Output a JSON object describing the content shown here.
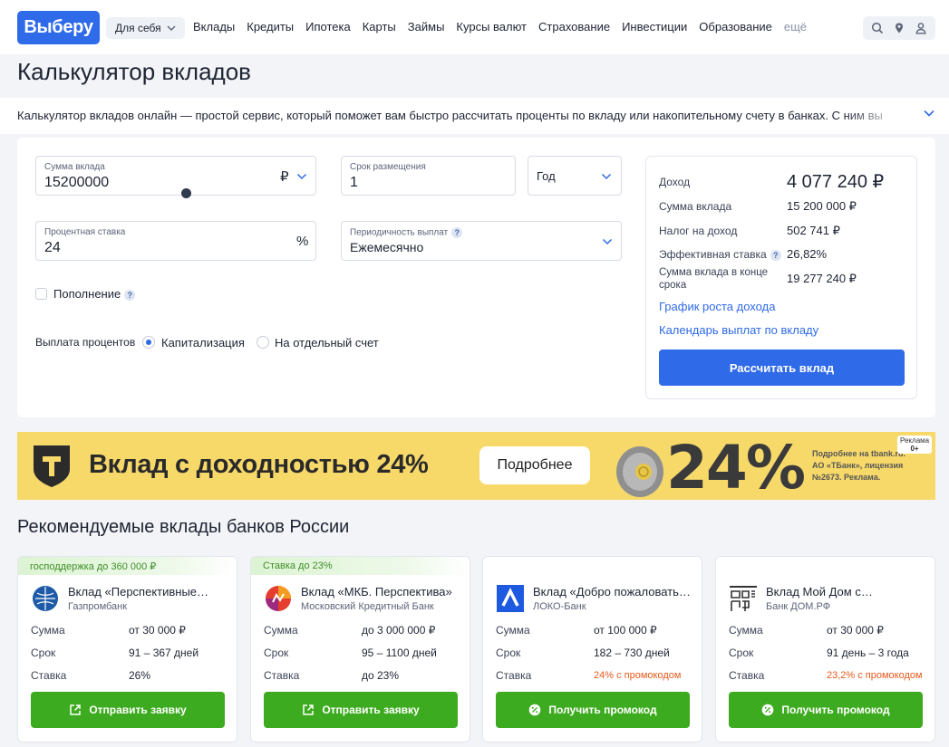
{
  "header": {
    "logo": "Выберу",
    "for_self": "Для себя",
    "nav": [
      "Вклады",
      "Кредиты",
      "Ипотека",
      "Карты",
      "Займы",
      "Курсы валют",
      "Страхование",
      "Инвестиции",
      "Образование"
    ],
    "more": "ещё",
    "icons": [
      "search-icon",
      "location-icon",
      "user-icon"
    ]
  },
  "page": {
    "title": "Калькулятор вкладов",
    "intro": "Калькулятор вкладов онлайн — простой сервис, который поможет вам быстро рассчитать проценты по вкладу или накопительному счету в банках. С ним вы"
  },
  "calculator": {
    "amount": {
      "label": "Сумма вклада",
      "value": "15200000",
      "currency": "₽"
    },
    "term": {
      "label": "Срок размещения",
      "value": "1",
      "unit": "Год"
    },
    "rate": {
      "label": "Процентная ставка",
      "value": "24",
      "suffix": "%"
    },
    "payout": {
      "label": "Периодичность выплат",
      "value": "Ежемесячно"
    },
    "topup": {
      "label": "Пополнение",
      "checked": false
    },
    "interest": {
      "label": "Выплата процентов",
      "options": [
        "Капитализация",
        "На отдельный счет"
      ],
      "selected": "Капитализация"
    },
    "slider_level": 0.73,
    "result": {
      "income_label": "Доход",
      "income_value": "4 077 240 ₽",
      "rows": [
        {
          "label": "Сумма вклада",
          "value": "15 200 000 ₽"
        },
        {
          "label": "Налог на доход",
          "value": "502 741 ₽"
        },
        {
          "label": "Эффективная ставка",
          "value": "26,82%"
        },
        {
          "label": "Сумма вклада в конце срока",
          "value": "19 277 240 ₽"
        }
      ],
      "links": [
        "График роста дохода",
        "Календарь выплат по вкладу"
      ],
      "button": "Рассчитать вклад"
    }
  },
  "banner": {
    "title": "Вклад с доходностью 24%",
    "button": "Подробнее",
    "big": "24%",
    "small": [
      "Подробнее на tbank.ru.",
      "АО «ТБанк», лицензия",
      "№2673. Реклама."
    ],
    "ad_label": "Реклама",
    "age": "0+"
  },
  "recommended": {
    "title": "Рекомендуемые вклады банков России",
    "labels": {
      "amount": "Сумма",
      "term": "Срок",
      "rate": "Ставка"
    },
    "cards": [
      {
        "promo": "господдержка до 360 000 ₽",
        "name": "Вклад «Перспективные…",
        "bank": "Газпромбанк",
        "amount": "от 30 000 ₽",
        "term": "91 – 367 дней",
        "rate": "26%",
        "button": "Отправить заявку",
        "logo": "gazprombank-logo"
      },
      {
        "promo": "Ставка до 23%",
        "name": "Вклад «МКБ. Перспектива»",
        "bank": "Московский Кредитный Банк",
        "amount": "до 3 000 000 ₽",
        "term": "95 – 1100 дней",
        "rate": "до 23%",
        "button": "Отправить заявку",
        "logo": "mkb-logo"
      },
      {
        "promo": "",
        "name": "Вклад «Добро пожаловать…",
        "bank": "ЛОКО-Банк",
        "amount": "от 100 000 ₽",
        "term": "182 – 730 дней",
        "rate": "24% с промокодом",
        "button": "Получить промокод",
        "logo": "loko-logo"
      },
      {
        "promo": "",
        "name": "Вклад Мой Дом с…",
        "bank": "Банк ДОМ.РФ",
        "amount": "от 30 000 ₽",
        "term": "91 день – 3 года",
        "rate": "23,2% с промокодом",
        "button": "Получить промокод",
        "logo": "domrf-logo"
      }
    ]
  },
  "colors": {
    "brand": "#2f6ae9",
    "green": "#3dab1f",
    "orange": "#e8591b",
    "banner": "#f7d96a"
  }
}
